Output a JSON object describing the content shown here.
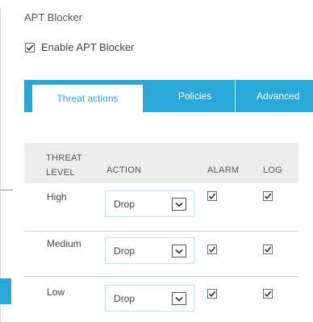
{
  "panel": {
    "title": "APT Blocker",
    "enable_label": "Enable APT Blocker",
    "enable_checked": true
  },
  "tabs": [
    {
      "label": "Threat actions",
      "active": true
    },
    {
      "label": "Policies",
      "active": false
    },
    {
      "label": "Advanced",
      "active": false
    }
  ],
  "table": {
    "headers": {
      "threat_level_line1": "THREAT",
      "threat_level_line2": "LEVEL",
      "action": "ACTION",
      "alarm": "ALARM",
      "log": "LOG"
    },
    "rows": [
      {
        "level": "High",
        "action": "Drop",
        "alarm": true,
        "log": true
      },
      {
        "level": "Medium",
        "action": "Drop",
        "alarm": true,
        "log": true
      },
      {
        "level": "Low",
        "action": "Drop",
        "alarm": true,
        "log": true
      }
    ]
  },
  "colors": {
    "accent": "#2aa7d9",
    "header_band": "#ececec"
  }
}
